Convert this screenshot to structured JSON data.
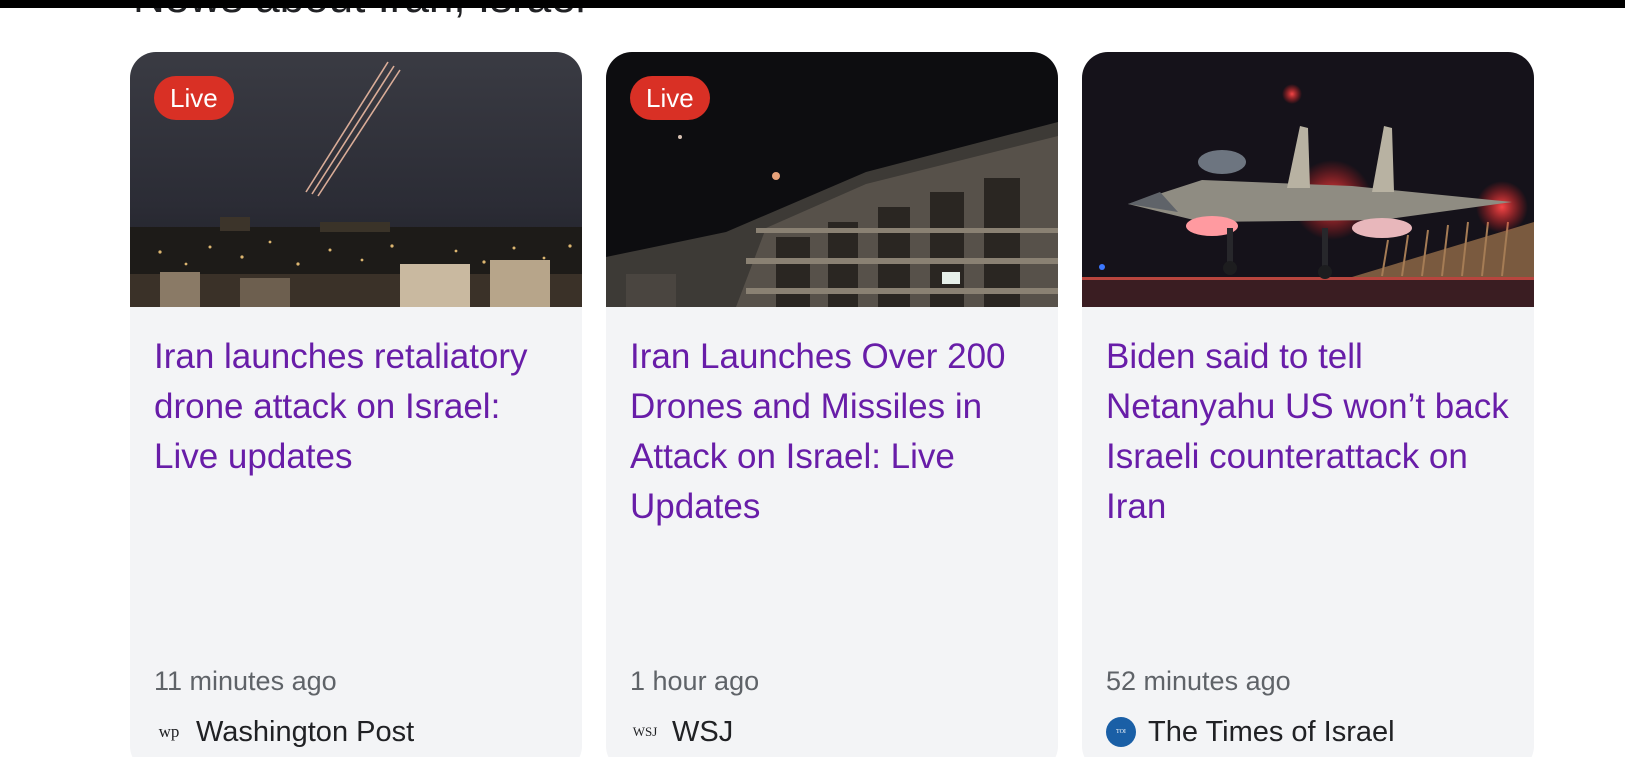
{
  "section": {
    "title": "News about Iran, Israel"
  },
  "cards": [
    {
      "badge": "Live",
      "headline": "Iran launches retaliatory drone attack on Israel: Live updates",
      "time": "11 minutes ago",
      "source": "Washington Post",
      "source_logo": "wp"
    },
    {
      "badge": "Live",
      "headline": "Iran Launches Over 200 Drones and Missiles in Attack on Israel: Live Updates",
      "time": "1 hour ago",
      "source": "WSJ",
      "source_logo": "WSJ"
    },
    {
      "headline": "Biden said to tell Netanyahu US won’t back Israeli counterattack on Iran",
      "time": "52 minutes ago",
      "source": "The Times of Israel",
      "source_logo": "TOI"
    }
  ],
  "colors": {
    "headline": "#681da8",
    "live_badge": "#d93025",
    "card_background": "#f3f4f6",
    "meta_text": "#5f6368"
  },
  "icons": {
    "card1_logo": "washington-post-logo",
    "card2_logo": "wsj-logo",
    "card3_logo": "times-of-israel-logo"
  }
}
